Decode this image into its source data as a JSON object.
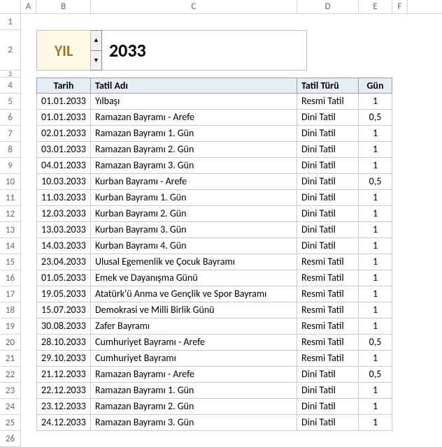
{
  "columns": [
    "A",
    "B",
    "C",
    "D",
    "E",
    "F"
  ],
  "rowNumbers": [
    1,
    2,
    3,
    4,
    5,
    6,
    7,
    8,
    9,
    10,
    11,
    12,
    13,
    14,
    15,
    16,
    17,
    18,
    19,
    20,
    21,
    22,
    23,
    24,
    25,
    26
  ],
  "year": {
    "label": "YIL",
    "value": "2033"
  },
  "table": {
    "headers": {
      "date": "Tarih",
      "name": "Tatil Adı",
      "type": "Tatil Türü",
      "days": "Gün"
    },
    "rows": [
      {
        "date": "01.01.2033",
        "name": "Yılbaşı",
        "type": "Resmi Tatil",
        "days": "1"
      },
      {
        "date": "01.01.2033",
        "name": "Ramazan Bayramı - Arefe",
        "type": "Dini Tatil",
        "days": "0,5"
      },
      {
        "date": "02.01.2033",
        "name": "Ramazan Bayramı 1. Gün",
        "type": "Dini Tatil",
        "days": "1"
      },
      {
        "date": "03.01.2033",
        "name": "Ramazan Bayramı 2. Gün",
        "type": "Dini Tatil",
        "days": "1"
      },
      {
        "date": "04.01.2033",
        "name": "Ramazan Bayramı 3. Gün",
        "type": "Dini Tatil",
        "days": "1"
      },
      {
        "date": "10.03.2033",
        "name": "Kurban Bayramı - Arefe",
        "type": "Dini Tatil",
        "days": "0,5"
      },
      {
        "date": "11.03.2033",
        "name": "Kurban Bayramı 1. Gün",
        "type": "Dini Tatil",
        "days": "1"
      },
      {
        "date": "12.03.2033",
        "name": "Kurban Bayramı 2. Gün",
        "type": "Dini Tatil",
        "days": "1"
      },
      {
        "date": "13.03.2033",
        "name": "Kurban Bayramı 3. Gün",
        "type": "Dini Tatil",
        "days": "1"
      },
      {
        "date": "14.03.2033",
        "name": "Kurban Bayramı 4. Gün",
        "type": "Dini Tatil",
        "days": "1"
      },
      {
        "date": "23.04.2033",
        "name": "Ulusal Egemenlik ve Çocuk Bayramı",
        "type": "Resmi Tatil",
        "days": "1"
      },
      {
        "date": "01.05.2033",
        "name": "Emek ve Dayanışma Günü",
        "type": "Resmi Tatil",
        "days": "1"
      },
      {
        "date": "19.05.2033",
        "name": "Atatürk'ü Anma ve Gençlik ve Spor Bayramı",
        "type": "Resmi Tatil",
        "days": "1"
      },
      {
        "date": "15.07.2033",
        "name": "Demokrasi ve Milli Birlik Günü",
        "type": "Resmi Tatil",
        "days": "1"
      },
      {
        "date": "30.08.2033",
        "name": "Zafer Bayramı",
        "type": "Resmi Tatil",
        "days": "1"
      },
      {
        "date": "28.10.2033",
        "name": "Cumhuriyet Bayramı - Arefe",
        "type": "Resmi Tatil",
        "days": "0,5"
      },
      {
        "date": "29.10.2033",
        "name": "Cumhuriyet Bayramı",
        "type": "Resmi Tatil",
        "days": "1"
      },
      {
        "date": "21.12.2033",
        "name": "Ramazan Bayramı - Arefe",
        "type": "Dini Tatil",
        "days": "0,5"
      },
      {
        "date": "22.12.2033",
        "name": "Ramazan Bayramı 1. Gün",
        "type": "Dini Tatil",
        "days": "1"
      },
      {
        "date": "23.12.2033",
        "name": "Ramazan Bayramı 2. Gün",
        "type": "Dini Tatil",
        "days": "1"
      },
      {
        "date": "24.12.2033",
        "name": "Ramazan Bayramı 3. Gün",
        "type": "Dini Tatil",
        "days": "1"
      }
    ]
  }
}
